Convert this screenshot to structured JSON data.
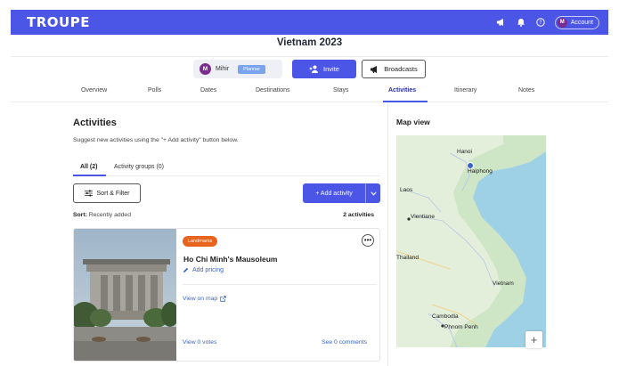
{
  "app": {
    "logo": "TROUPE",
    "account_label": "Account",
    "account_initial": "M"
  },
  "trip": {
    "title": "Vietnam 2023"
  },
  "member": {
    "initial": "M",
    "name": "Mihir",
    "role": "Planner"
  },
  "actions": {
    "invite_label": "Invite",
    "broadcasts_label": "Broadcasts"
  },
  "tabs": [
    "Overview",
    "Polls",
    "Dates",
    "Destinations",
    "Stays",
    "Activities",
    "Itinerary",
    "Notes"
  ],
  "active_tab": "Activities",
  "activities": {
    "title": "Activities",
    "hint": "Suggest new activities using the \"+ Add activity\" button below.",
    "subtabs": [
      "All (2)",
      "Activity groups (0)"
    ],
    "sort_filter_label": "Sort & Filter",
    "add_label": "+ Add activity",
    "sort_prefix": "Sort:",
    "sort_value": "Recently added",
    "count": "2 activities"
  },
  "card": {
    "category": "Landmarks",
    "title": "Ho Chi Minh's Mausoleum",
    "pricing": "Add pricing",
    "view_map": "View on map",
    "votes": "View 0 votes",
    "comments": "See 0 comments"
  },
  "map": {
    "title": "Map view",
    "labels": [
      "Hanoi",
      "Haiphong",
      "Laos",
      "Vientiane",
      "Thailand",
      "Vietnam",
      "Cambodia",
      "Phnom Penh"
    ],
    "zoom_label": "+"
  },
  "colors": {
    "brand": "#4b55e6",
    "badge": "#e8641e",
    "link": "#3a64c9"
  }
}
